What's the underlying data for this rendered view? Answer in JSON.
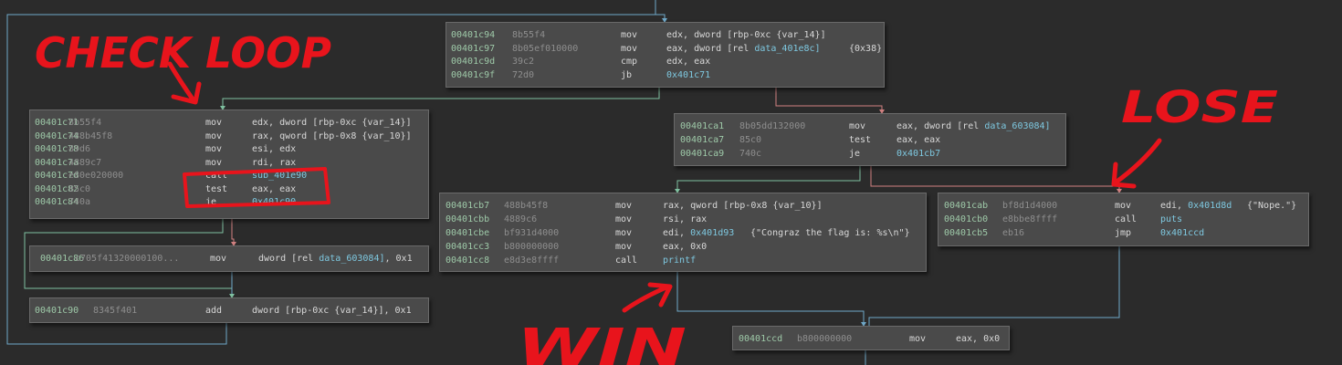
{
  "blocks": {
    "b1": [
      {
        "addr": "00401c94",
        "bytes": "8b55f4",
        "mn": "mov",
        "op": "edx, dword [rbp-0xc {var_14}]",
        "sym": "",
        "ann": ""
      },
      {
        "addr": "00401c97",
        "bytes": "8b05ef010000",
        "mn": "mov",
        "op": "eax, dword [rel ",
        "sym": "data_401e8c]",
        "ann": "{0x38}"
      },
      {
        "addr": "00401c9d",
        "bytes": "39c2",
        "mn": "cmp",
        "op": "edx, eax",
        "sym": "",
        "ann": ""
      },
      {
        "addr": "00401c9f",
        "bytes": "72d0",
        "mn": "jb",
        "op": "",
        "sym": "0x401c71",
        "ann": ""
      }
    ],
    "b2": [
      {
        "addr": "00401c71",
        "bytes": "8b55f4",
        "mn": "mov",
        "op": "edx, dword [rbp-0xc {var_14}]",
        "sym": "",
        "ann": ""
      },
      {
        "addr": "00401c74",
        "bytes": "488b45f8",
        "mn": "mov",
        "op": "rax, qword [rbp-0x8 {var_10}]",
        "sym": "",
        "ann": ""
      },
      {
        "addr": "00401c78",
        "bytes": "89d6",
        "mn": "mov",
        "op": "esi, edx",
        "sym": "",
        "ann": ""
      },
      {
        "addr": "00401c7a",
        "bytes": "4889c7",
        "mn": "mov",
        "op": "rdi, rax",
        "sym": "",
        "ann": ""
      },
      {
        "addr": "00401c7d",
        "bytes": "e80e020000",
        "mn": "call",
        "op": "",
        "sym": "sub_401e90",
        "ann": ""
      },
      {
        "addr": "00401c82",
        "bytes": "85c0",
        "mn": "test",
        "op": "eax, eax",
        "sym": "",
        "ann": ""
      },
      {
        "addr": "00401c84",
        "bytes": "740a",
        "mn": "je",
        "op": "",
        "sym": "0x401c90",
        "ann": ""
      }
    ],
    "b3": [
      {
        "addr": "00401c86",
        "bytes": "c705f41320000100...",
        "mn": "mov",
        "op": "dword [rel ",
        "sym": "data_603084]",
        "ann": ", 0x1"
      }
    ],
    "b4": [
      {
        "addr": "00401c90",
        "bytes": "8345f401",
        "mn": "add",
        "op": "dword [rbp-0xc {var_14}], 0x1",
        "sym": "",
        "ann": ""
      }
    ],
    "b5": [
      {
        "addr": "00401ca1",
        "bytes": "8b05dd132000",
        "mn": "mov",
        "op": "eax, dword [rel ",
        "sym": "data_603084]",
        "ann": ""
      },
      {
        "addr": "00401ca7",
        "bytes": "85c0",
        "mn": "test",
        "op": "eax, eax",
        "sym": "",
        "ann": ""
      },
      {
        "addr": "00401ca9",
        "bytes": "740c",
        "mn": "je",
        "op": "",
        "sym": "0x401cb7",
        "ann": ""
      }
    ],
    "b6": [
      {
        "addr": "00401cb7",
        "bytes": "488b45f8",
        "mn": "mov",
        "op": "rax, qword [rbp-0x8 {var_10}]",
        "sym": "",
        "ann": ""
      },
      {
        "addr": "00401cbb",
        "bytes": "4889c6",
        "mn": "mov",
        "op": "rsi, rax",
        "sym": "",
        "ann": ""
      },
      {
        "addr": "00401cbe",
        "bytes": "bf931d4000",
        "mn": "mov",
        "op": "edi, ",
        "sym": "0x401d93",
        "ann": "{\"Congraz the flag is: %s\\n\"}"
      },
      {
        "addr": "00401cc3",
        "bytes": "b800000000",
        "mn": "mov",
        "op": "eax, 0x0",
        "sym": "",
        "ann": ""
      },
      {
        "addr": "00401cc8",
        "bytes": "e8d3e8ffff",
        "mn": "call",
        "op": "",
        "sym": "printf",
        "ann": ""
      }
    ],
    "b7": [
      {
        "addr": "00401cab",
        "bytes": "bf8d1d4000",
        "mn": "mov",
        "op": "edi, ",
        "sym": "0x401d8d",
        "ann": "{\"Nope.\"}"
      },
      {
        "addr": "00401cb0",
        "bytes": "e8bbe8ffff",
        "mn": "call",
        "op": "",
        "sym": "puts",
        "ann": ""
      },
      {
        "addr": "00401cb5",
        "bytes": "eb16",
        "mn": "jmp",
        "op": "",
        "sym": "0x401ccd",
        "ann": ""
      }
    ],
    "b8": [
      {
        "addr": "00401ccd",
        "bytes": "b800000000",
        "mn": "mov",
        "op": "eax, 0x0",
        "sym": "",
        "ann": ""
      }
    ]
  },
  "annotations": {
    "check_loop": "CHECK LOOP",
    "lose": "LOSE",
    "win": "WIN"
  },
  "colors": {
    "background": "#2b2b2b",
    "block_bg": "#4a4a4a",
    "address": "#9ec9a8",
    "symbol": "#7ec8e0",
    "edge_unconditional": "#6fa8c8",
    "edge_true": "#7fc0a0",
    "edge_false": "#d08080",
    "annotation_red": "#e8141c"
  }
}
